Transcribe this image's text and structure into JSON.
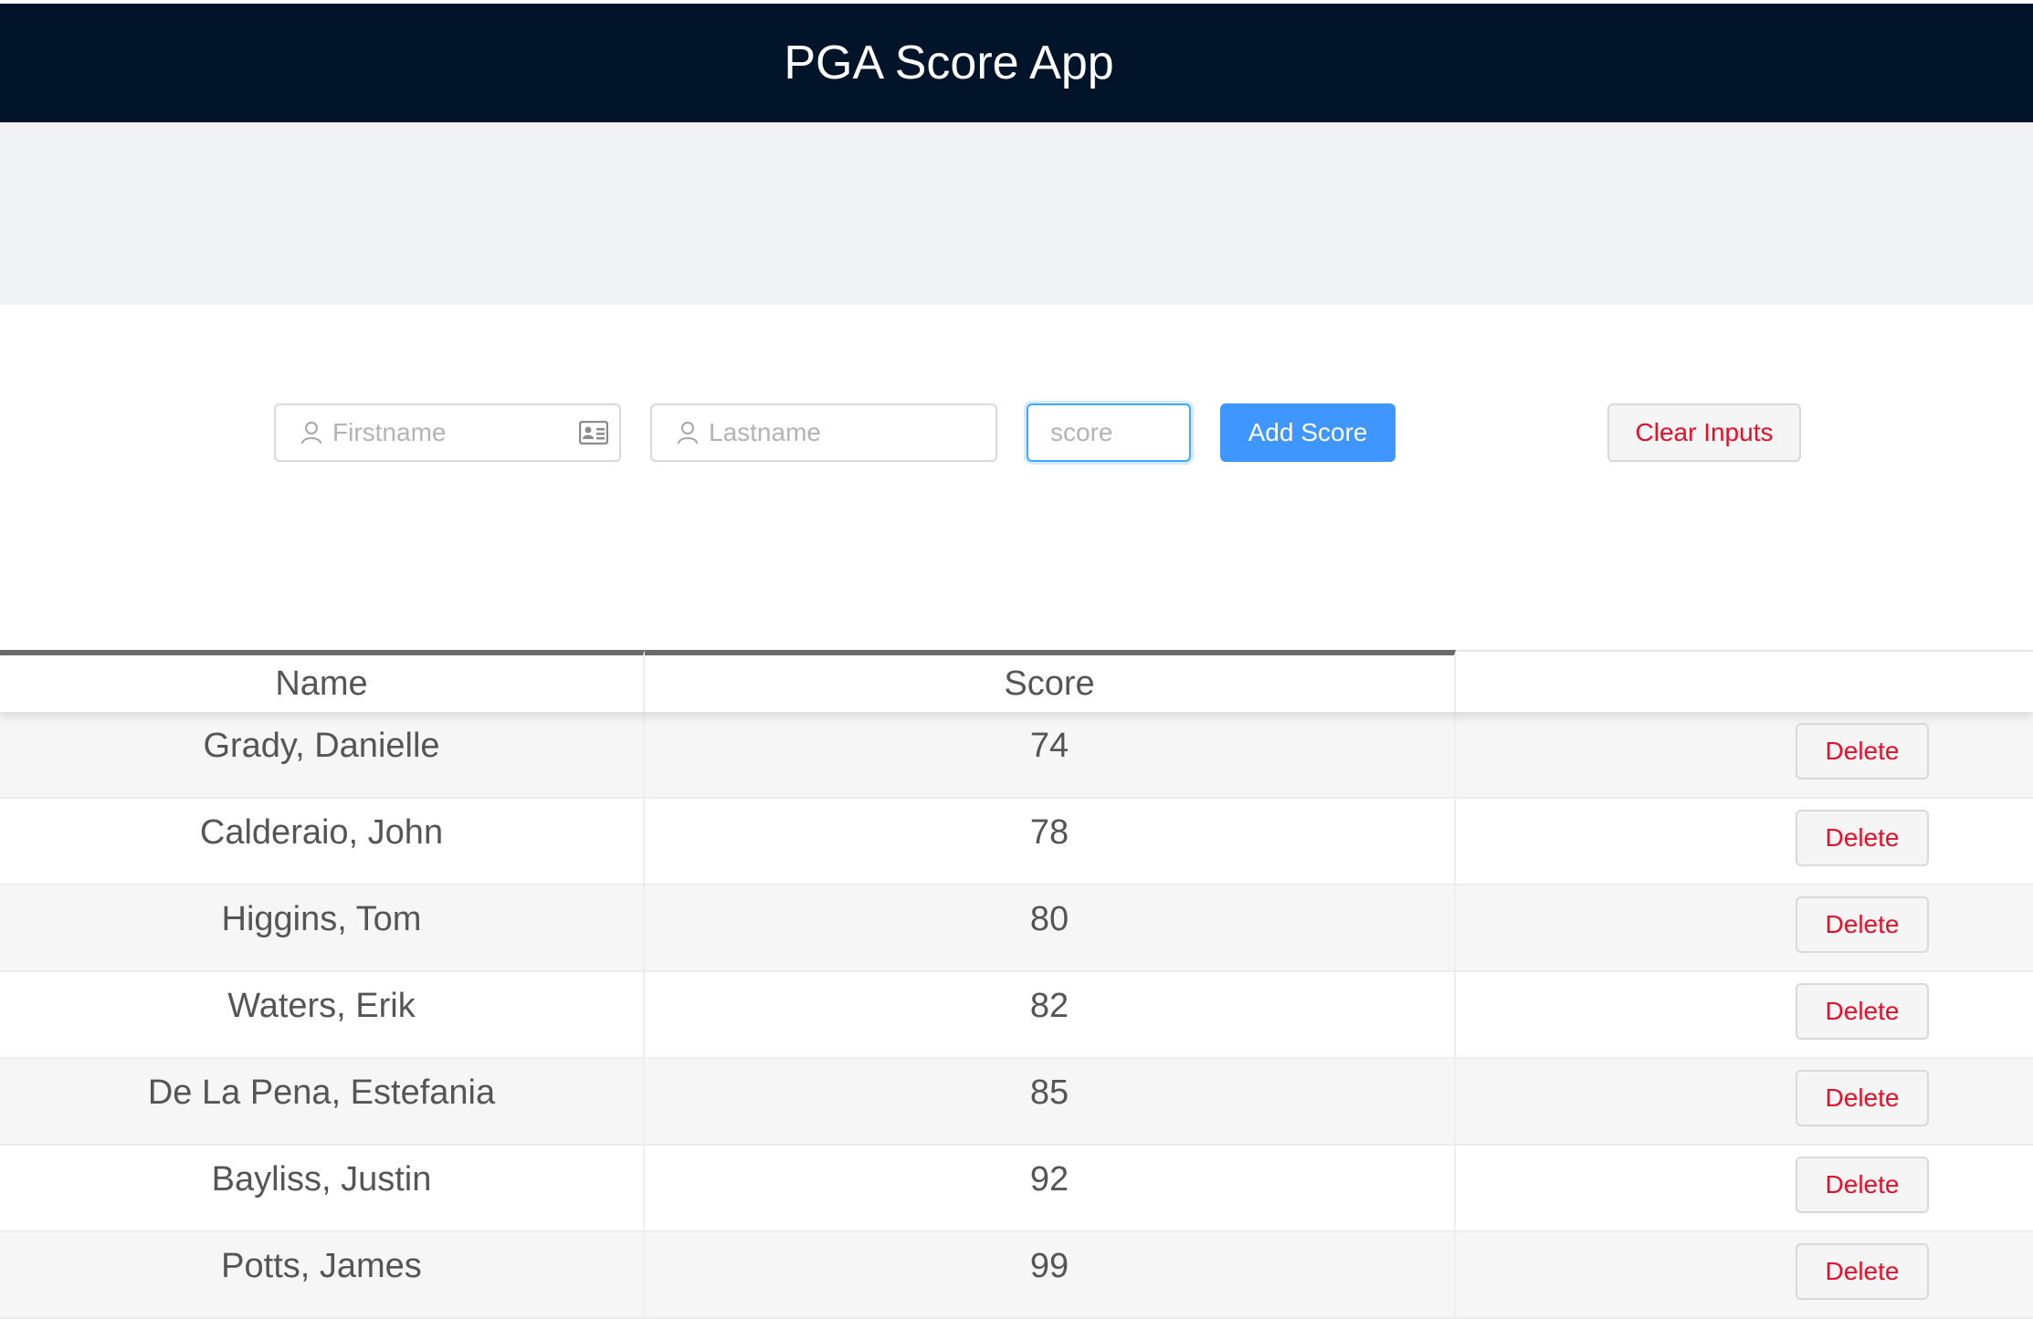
{
  "app": {
    "title": "PGA Score App"
  },
  "form": {
    "firstname_placeholder": "Firstname",
    "lastname_placeholder": "Lastname",
    "score_placeholder": "score",
    "add_label": "Add Score",
    "clear_label": "Clear Inputs"
  },
  "table": {
    "headers": {
      "name": "Name",
      "score": "Score",
      "action": ""
    },
    "delete_label": "Delete",
    "rows": [
      {
        "name": "Grady, Danielle",
        "score": "74"
      },
      {
        "name": "Calderaio, John",
        "score": "78"
      },
      {
        "name": "Higgins, Tom",
        "score": "80"
      },
      {
        "name": "Waters, Erik",
        "score": "82"
      },
      {
        "name": "De La Pena, Estefania",
        "score": "85"
      },
      {
        "name": "Bayliss, Justin",
        "score": "92"
      },
      {
        "name": "Potts, James",
        "score": "99"
      }
    ]
  },
  "colors": {
    "header_bg": "#011429",
    "primary": "#4096ff",
    "danger": "#e0112b"
  }
}
